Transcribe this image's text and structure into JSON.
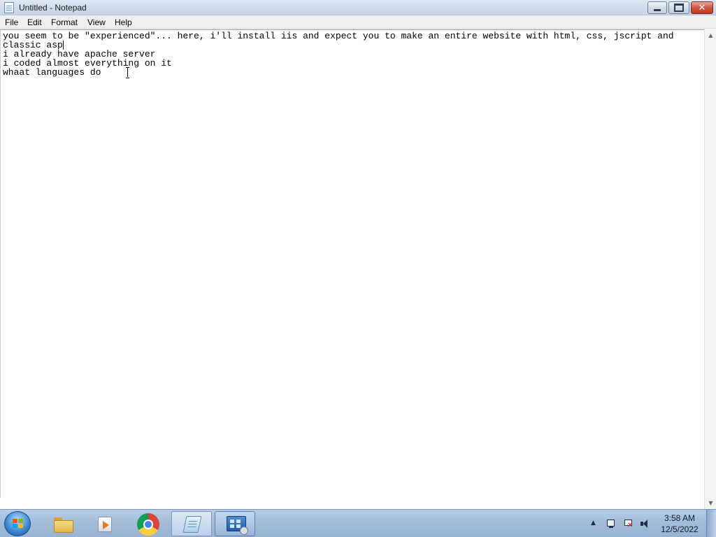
{
  "window": {
    "title": "Untitled - Notepad",
    "close_glyph": "✕"
  },
  "menu": {
    "file": "File",
    "edit": "Edit",
    "format": "Format",
    "view": "View",
    "help": "Help"
  },
  "editor": {
    "line1": "you seem to be \"experienced\"... here, i'll install iis and expect you to make an entire website with html, css, jscript and classic asp",
    "line2": "i already have apache server",
    "line3": "i coded almost everything on it",
    "line4": "whaat languages do"
  },
  "scrollbar": {
    "up_glyph": "▲",
    "down_glyph": "▼"
  },
  "taskbar": {
    "pinned": [
      {
        "name": "Windows Explorer",
        "icon": "folder-icon"
      },
      {
        "name": "Windows Media Player",
        "icon": "media-player-icon"
      },
      {
        "name": "Google Chrome",
        "icon": "chrome-icon"
      },
      {
        "name": "Notepad",
        "icon": "notepad-icon"
      },
      {
        "name": "Control Panel",
        "icon": "control-panel-icon"
      }
    ],
    "tray_arrow": "▲",
    "time": "3:58 AM",
    "date": "12/5/2022"
  }
}
